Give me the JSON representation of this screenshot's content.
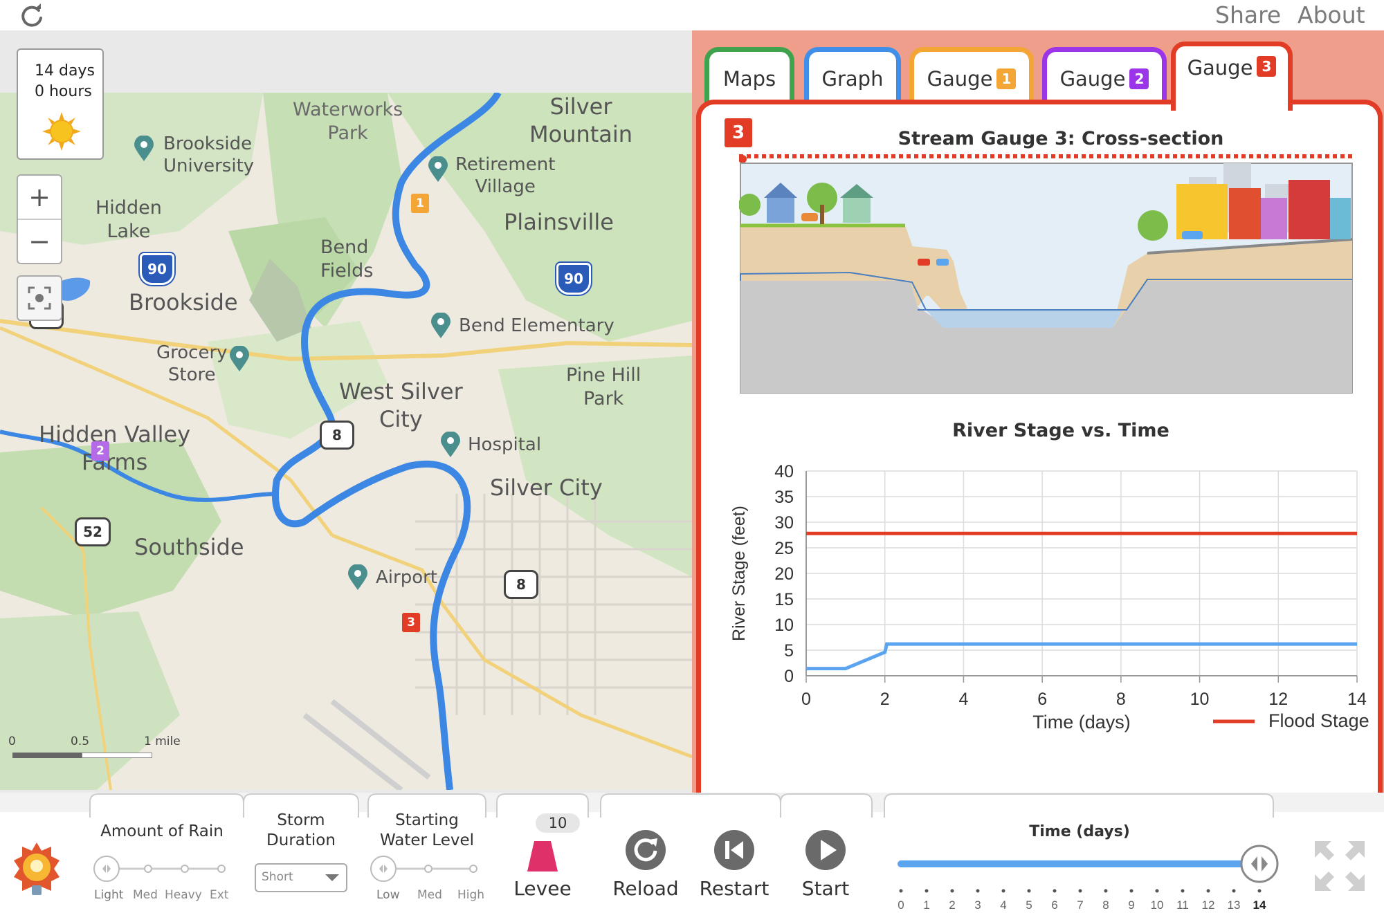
{
  "topbar": {
    "share_label": "Share",
    "about_label": "About"
  },
  "sim_time": {
    "days_text": "14 days",
    "hours_text": "0 hours",
    "weather": "sun-icon"
  },
  "map": {
    "labels": {
      "waterworks_park": [
        "Waterworks",
        "Park"
      ],
      "silver_mountain": [
        "Silver",
        "Mountain"
      ],
      "brookside_university": [
        "Brookside",
        "University"
      ],
      "retirement_village": [
        "Retirement",
        "Village"
      ],
      "hidden_lake": [
        "Hidden",
        "Lake"
      ],
      "plainsville": "Plainsville",
      "bend_fields": [
        "Bend",
        "Fields"
      ],
      "brookside": "Brookside",
      "bend_elementary": "Bend Elementary",
      "grocery_store": [
        "Grocery",
        "Store"
      ],
      "pine_hill_park": [
        "Pine Hill",
        "Park"
      ],
      "west_silver_city": [
        "West Silver",
        "City"
      ],
      "hidden_valley_farms": [
        "Hidden Valley",
        "Farms"
      ],
      "hospital": "Hospital",
      "silver_city": "Silver City",
      "southside": "Southside",
      "airport": "Airport"
    },
    "shields": {
      "i90_west": "90",
      "i90_east": "90",
      "us8_west": "8",
      "us8_mid": "8",
      "us8_south": "8",
      "us52": "52"
    },
    "gauges": {
      "g1": "1",
      "g2": "2",
      "g3": "3"
    },
    "scale": {
      "zero": "0",
      "half": "0.5",
      "mile": "1 mile"
    }
  },
  "tabs": [
    {
      "label": "Maps",
      "color": "#3fa34d"
    },
    {
      "label": "Graph",
      "color": "#3f8fe8"
    },
    {
      "label": "Gauge",
      "badge": "1",
      "color": "#f3a535"
    },
    {
      "label": "Gauge",
      "badge": "2",
      "color": "#9a36e8"
    },
    {
      "label": "Gauge",
      "badge": "3",
      "color": "#e23c26"
    }
  ],
  "cross_section": {
    "title": "Stream Gauge 3: Cross-section",
    "badge": "3"
  },
  "chart_data": {
    "type": "line",
    "title": "River Stage vs. Time",
    "xlabel": "Time (days)",
    "ylabel": "River Stage (feet)",
    "xlim": [
      0,
      14
    ],
    "ylim": [
      0,
      40
    ],
    "xticks": [
      "0",
      "2",
      "4",
      "6",
      "8",
      "10",
      "12",
      "14"
    ],
    "yticks": [
      "0",
      "5",
      "10",
      "15",
      "20",
      "25",
      "30",
      "35",
      "40"
    ],
    "grid": true,
    "legend": "bottom-right",
    "series": [
      {
        "name": "Flood Stage",
        "color": "#e23c26",
        "x": [
          0,
          14
        ],
        "y": [
          27.8,
          27.8
        ]
      },
      {
        "name": "",
        "color": "#5ba4ef",
        "x": [
          0,
          1,
          2,
          2.05,
          14
        ],
        "y": [
          1.4,
          1.4,
          4.6,
          6.2,
          6.2
        ]
      }
    ]
  },
  "controls": {
    "rain": {
      "title": "Amount of Rain",
      "options": [
        "Light",
        "Med",
        "Heavy",
        "Ext"
      ],
      "selected": "Light"
    },
    "duration": {
      "title": [
        "Storm",
        "Duration"
      ],
      "selected": "Short"
    },
    "water_level": {
      "title": [
        "Starting",
        "Water Level"
      ],
      "options": [
        "Low",
        "Med",
        "High"
      ],
      "selected": "Low"
    },
    "levee": {
      "count": "10",
      "label": "Levee",
      "color": "#e0306a"
    },
    "reload_label": "Reload",
    "restart_label": "Restart",
    "start_label": "Start",
    "time": {
      "title": "Time (days)",
      "ticks": [
        "0",
        "1",
        "2",
        "3",
        "4",
        "5",
        "6",
        "7",
        "8",
        "9",
        "10",
        "11",
        "12",
        "13",
        "14"
      ],
      "value": 14
    }
  }
}
